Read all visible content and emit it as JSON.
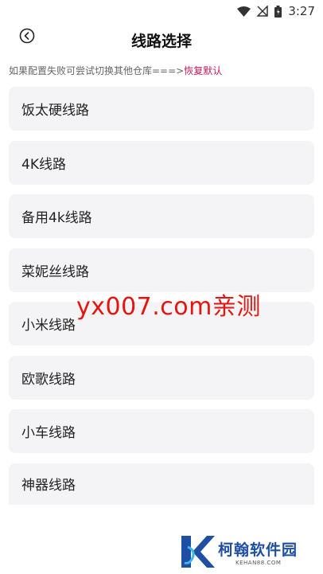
{
  "status_bar": {
    "time": "3:27"
  },
  "header": {
    "title": "线路选择"
  },
  "hint": {
    "text": "如果配置失败可尝试切换其他仓库===>",
    "restore_label": "恢复默认"
  },
  "routes": [
    {
      "label": "饭太硬线路"
    },
    {
      "label": "4K线路"
    },
    {
      "label": "备用4k线路"
    },
    {
      "label": "菜妮丝线路"
    },
    {
      "label": "小米线路"
    },
    {
      "label": "欧歌线路"
    },
    {
      "label": "小车线路"
    },
    {
      "label": "神器线路"
    }
  ],
  "watermark": {
    "text": "yx007.com亲测"
  },
  "brand": {
    "name": "柯翰软件园",
    "url": "KEHAN88.COM"
  },
  "colors": {
    "accent": "#c2185b",
    "watermark": "#e8130c",
    "brand": "#1f4fa3",
    "card_bg": "#f4f4f6"
  }
}
